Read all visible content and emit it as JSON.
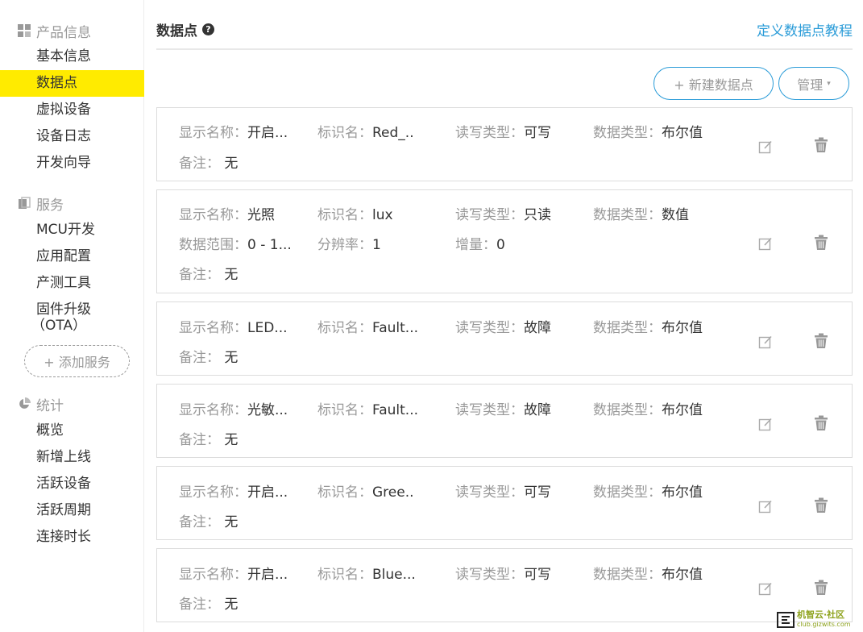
{
  "sidebar": {
    "product_section": "产品信息",
    "product_items": [
      "基本信息",
      "数据点",
      "虚拟设备",
      "设备日志",
      "开发向导"
    ],
    "service_section": "服务",
    "service_items": [
      "MCU开发",
      "应用配置",
      "产测工具"
    ],
    "firmware_line1": "固件升级",
    "firmware_line2": "（OTA）",
    "add_service": "+ 添加服务",
    "stats_section": "统计",
    "stats_items": [
      "概览",
      "新增上线",
      "活跃设备",
      "活跃周期",
      "连接时长"
    ]
  },
  "main": {
    "title": "数据点",
    "help_icon": "?",
    "tutorial_link": "定义数据点教程",
    "new_button": "+ 新建数据点",
    "manage_button": "管理",
    "manage_caret": "▾"
  },
  "labels": {
    "display_name": "显示名称：",
    "identifier": "标识名：",
    "rw_type": "读写类型：",
    "data_type": "数据类型：",
    "data_range": "数据范围：",
    "resolution": "分辨率：",
    "increment": "增量：",
    "remark": "备注："
  },
  "datapoints": [
    {
      "name": "开启...",
      "id": "Red_..",
      "rw": "可写",
      "type": "布尔值",
      "remark": "无"
    },
    {
      "name": "光照",
      "id": "lux",
      "rw": "只读",
      "type": "数值",
      "range": "0 - 1...",
      "resolution": "1",
      "increment": "0",
      "remark": "无"
    },
    {
      "name": "LED...",
      "id": "Fault...",
      "rw": "故障",
      "type": "布尔值",
      "remark": "无"
    },
    {
      "name": "光敏...",
      "id": "Fault...",
      "rw": "故障",
      "type": "布尔值",
      "remark": "无"
    },
    {
      "name": "开启...",
      "id": "Gree..",
      "rw": "可写",
      "type": "布尔值",
      "remark": "无"
    },
    {
      "name": "开启...",
      "id": "Blue...",
      "rw": "可写",
      "type": "布尔值",
      "remark": "无"
    }
  ],
  "icons": {
    "edit": "edit-icon",
    "delete": "trash-icon"
  },
  "colors": {
    "accent": "#2b9cd8",
    "active_nav": "#ffeb00"
  },
  "watermark": {
    "brand": "机智云·社区",
    "url": "club.gizwits.com"
  }
}
